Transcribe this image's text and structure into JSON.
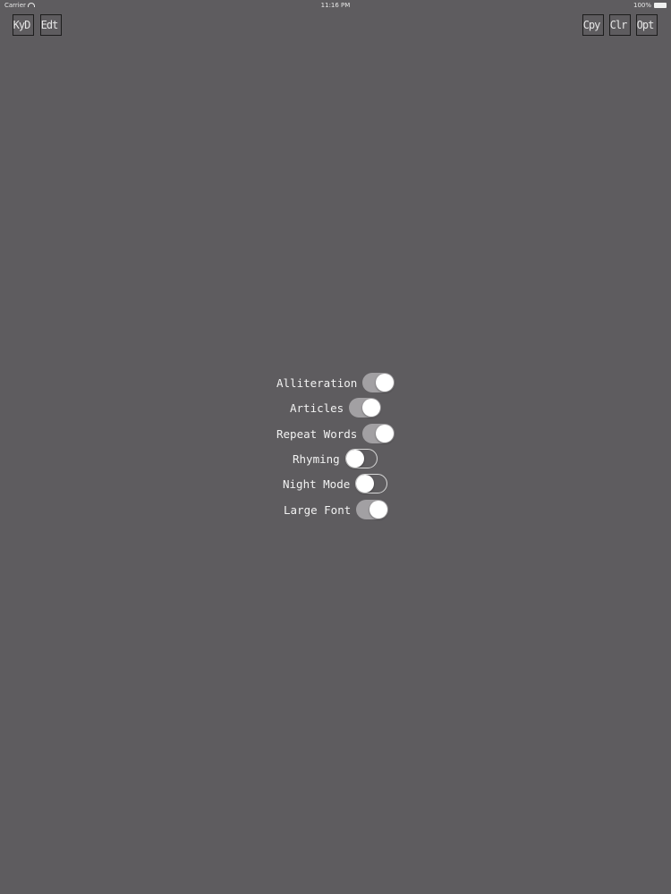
{
  "status_bar": {
    "carrier": "Carrier",
    "time": "11:16 PM",
    "battery": "100%"
  },
  "toolbar": {
    "left": [
      {
        "id": "keyboard",
        "label": "KyD"
      },
      {
        "id": "edit",
        "label": "Edt"
      }
    ],
    "right": [
      {
        "id": "copy",
        "label": "Cpy"
      },
      {
        "id": "clear",
        "label": "Clr"
      },
      {
        "id": "options",
        "label": "Opt"
      }
    ]
  },
  "settings": [
    {
      "label": "Alliteration",
      "on": true
    },
    {
      "label": "Articles",
      "on": true
    },
    {
      "label": "Repeat Words",
      "on": true
    },
    {
      "label": "Rhyming",
      "on": false
    },
    {
      "label": "Night Mode",
      "on": false
    },
    {
      "label": "Large Font",
      "on": true
    }
  ],
  "colors": {
    "background": "#5e5c5f",
    "toggle_on": "#a2a0a3",
    "knob": "#ffffff",
    "text": "#f2f2f2"
  }
}
